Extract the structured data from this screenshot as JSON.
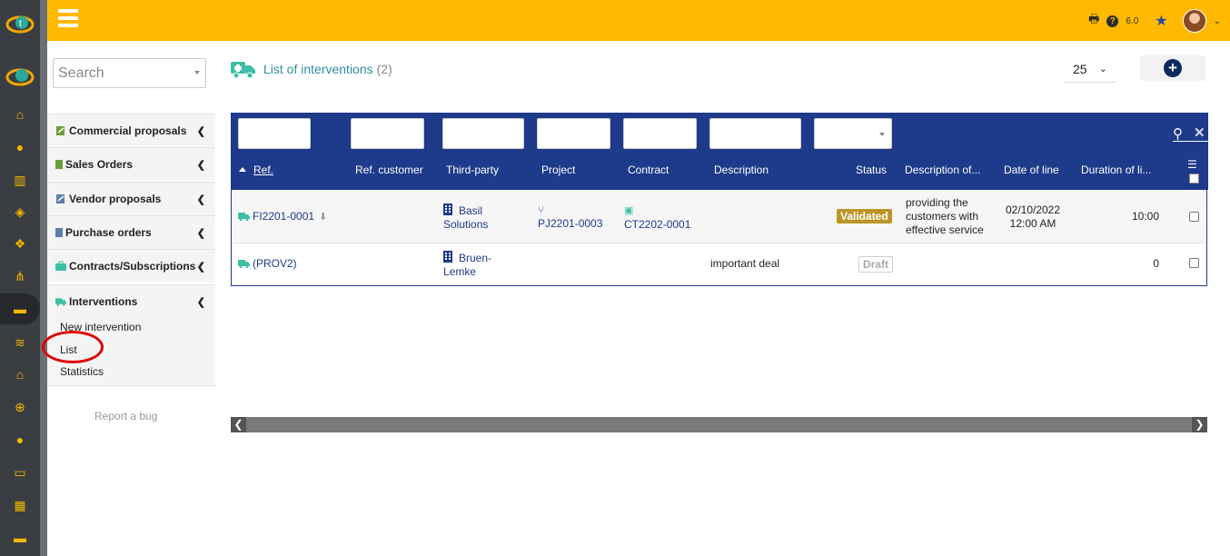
{
  "topbar": {
    "version": "6.0"
  },
  "menu": {
    "search_placeholder": "Search",
    "sections": [
      {
        "label": "Commercial proposals"
      },
      {
        "label": "Sales Orders"
      },
      {
        "label": "Vendor proposals"
      },
      {
        "label": "Purchase orders"
      },
      {
        "label": "Contracts/Subscriptions"
      },
      {
        "label": "Interventions"
      }
    ],
    "sub_items": [
      {
        "label": "New intervention"
      },
      {
        "label": "List"
      },
      {
        "label": "Statistics"
      }
    ],
    "report_bug": "Report a bug"
  },
  "page": {
    "title": "List of interventions",
    "count": "(2)",
    "limit": "25"
  },
  "table": {
    "headers": {
      "ref": "Ref.",
      "ref_customer": "Ref. customer",
      "third_party": "Third-party",
      "project": "Project",
      "contract": "Contract",
      "description": "Description",
      "status": "Status",
      "desc_line": "Description of...",
      "date_line": "Date of line",
      "duration_line": "Duration of li..."
    },
    "rows": [
      {
        "ref": "FI2201-0001",
        "third_party_l1": "Basil",
        "third_party_l2": "Solutions",
        "project": "PJ2201-0003",
        "contract": "CT2202-0001",
        "description": "",
        "status": "Validated",
        "desc_l1": "providing the",
        "desc_l2": "customers with",
        "desc_l3": "effective service",
        "date_l1": "02/10/2022",
        "date_l2": "12:00 AM",
        "duration": "10:00"
      },
      {
        "ref": "(PROV2)",
        "third_party_l1": "Bruen-",
        "third_party_l2": "Lemke",
        "project": "",
        "contract": "",
        "description": "important deal",
        "status": "Draft",
        "duration": "0"
      }
    ]
  },
  "colors": {
    "topbar": "#ffb900",
    "table_header": "#1e3a8a",
    "accent": "#2f8f9e",
    "rail": "#3a3d41",
    "validated_badge": "#bc9526",
    "annotation": "#e00000"
  },
  "icons": {
    "rail": [
      "home-icon",
      "user-icon",
      "building-icon",
      "box-icon",
      "cubes-icon",
      "project-icon",
      "briefcase-icon",
      "coins-icon",
      "bank-icon",
      "search-dollar-icon",
      "user-tie-icon",
      "folder-icon",
      "calendar-icon",
      "ticket-icon"
    ]
  }
}
